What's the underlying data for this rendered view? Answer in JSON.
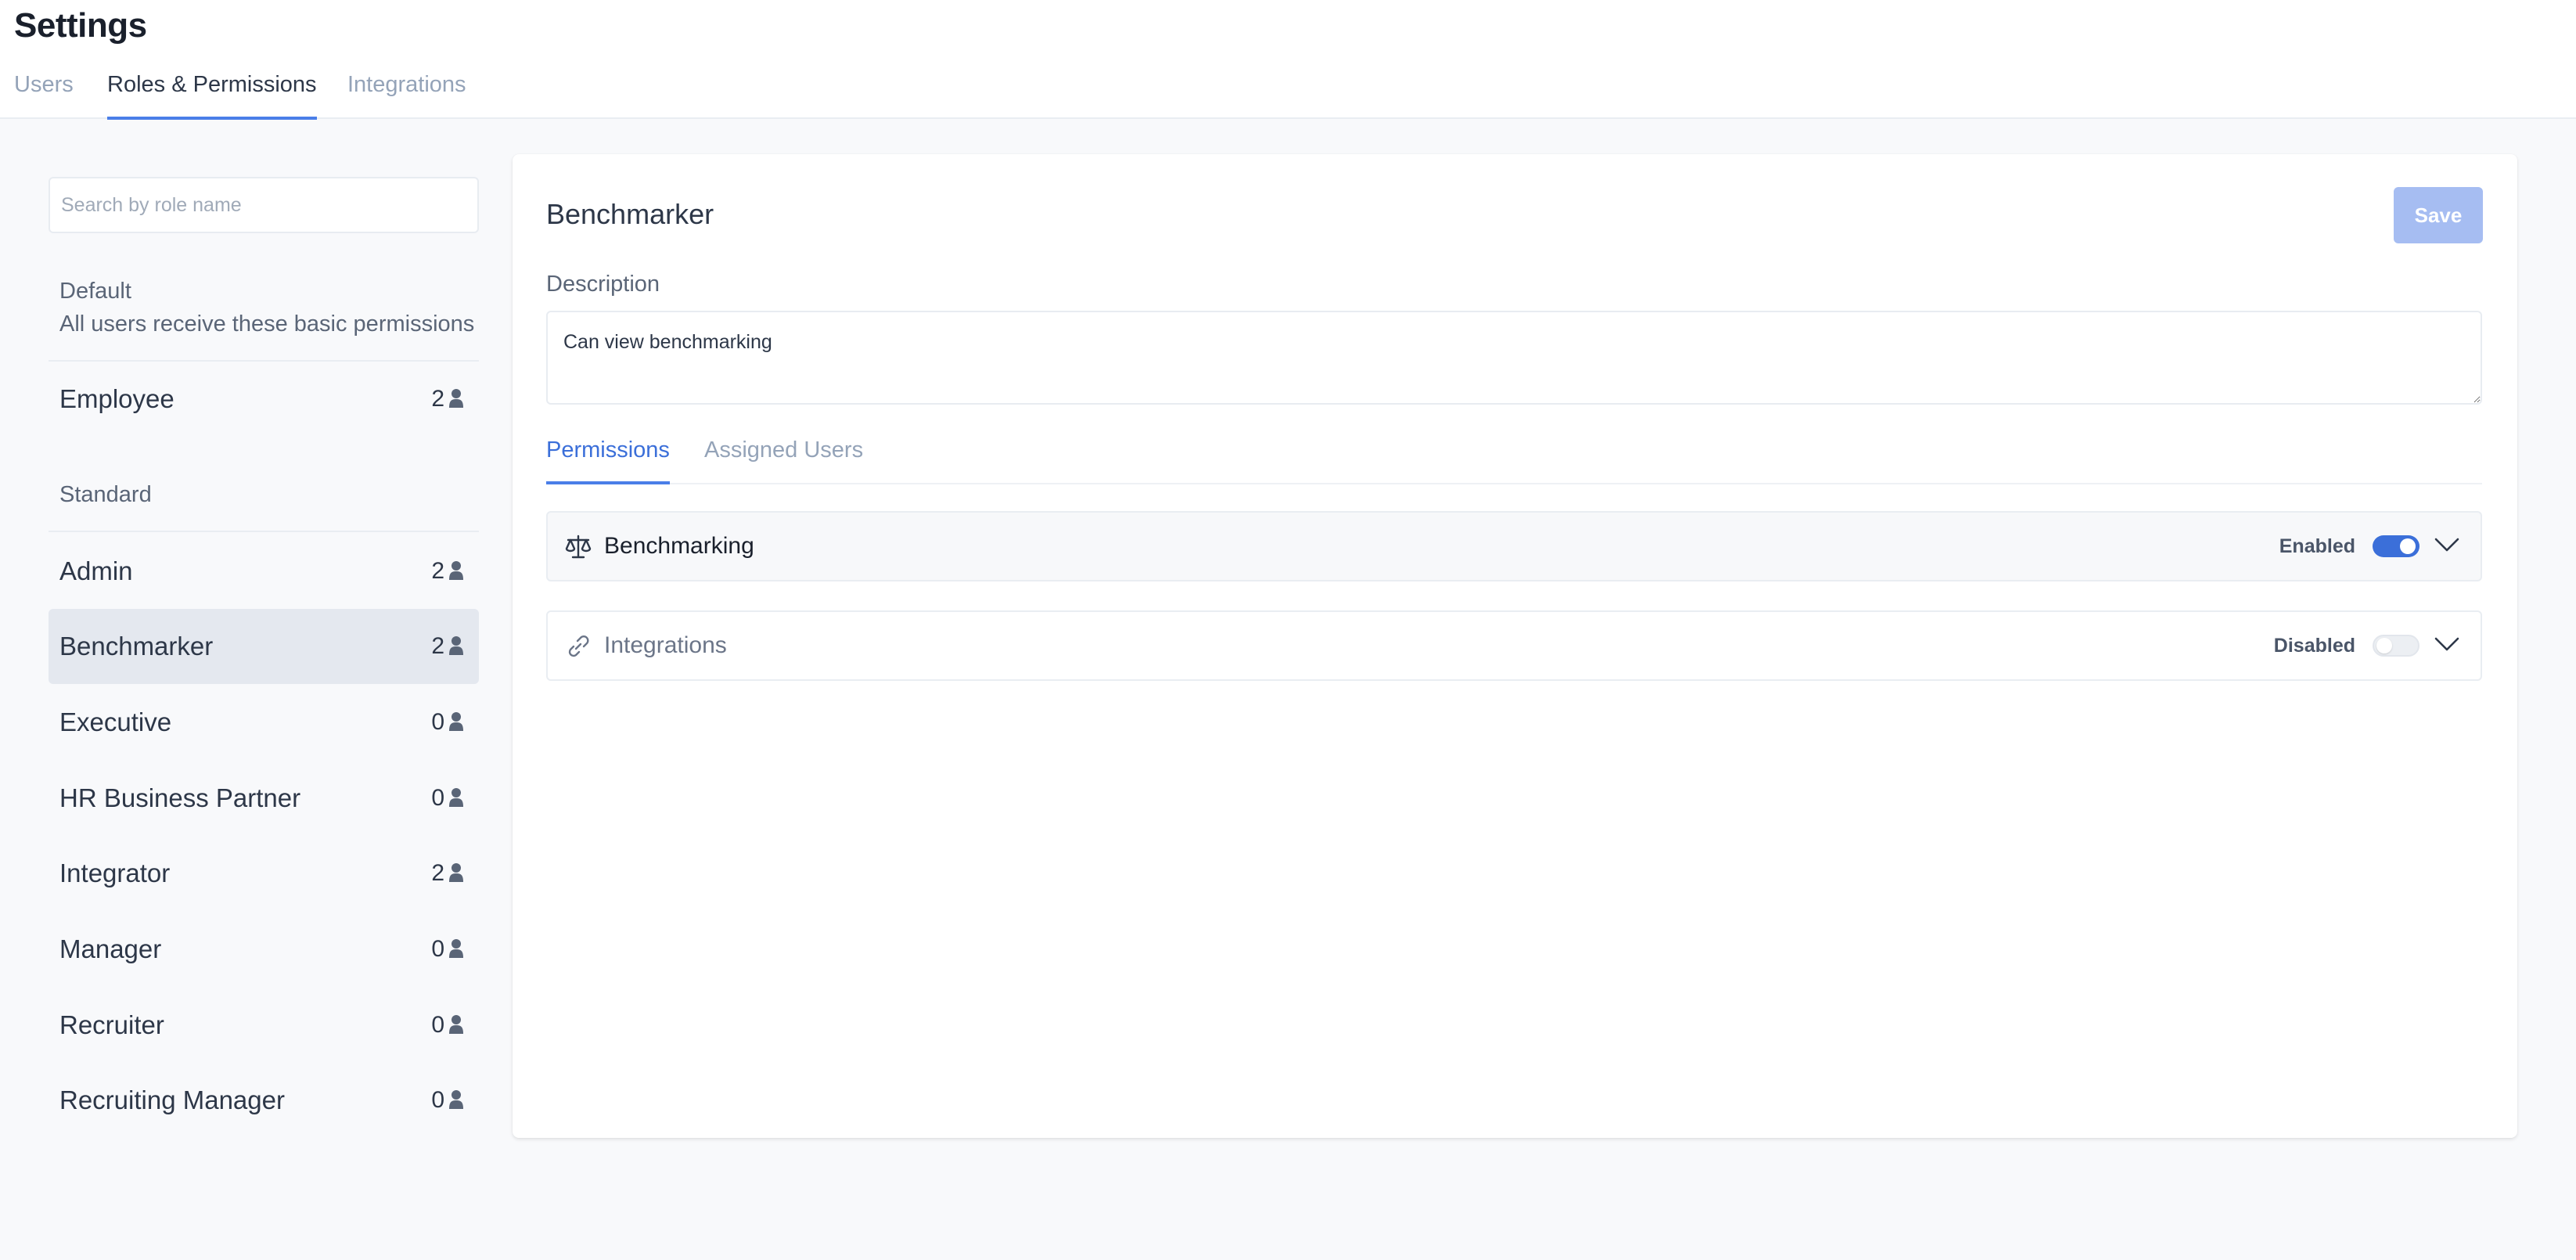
{
  "page": {
    "title": "Settings"
  },
  "top_tabs": [
    {
      "label": "Users",
      "active": false
    },
    {
      "label": "Roles & Permissions",
      "active": true
    },
    {
      "label": "Integrations",
      "active": false
    }
  ],
  "sidebar": {
    "search_placeholder": "Search by role name",
    "default_group": {
      "title": "Default",
      "subtitle": "All users receive these basic permissions",
      "roles": [
        {
          "name": "Employee",
          "count": "2"
        }
      ]
    },
    "standard_group": {
      "title": "Standard",
      "roles": [
        {
          "name": "Admin",
          "count": "2"
        },
        {
          "name": "Benchmarker",
          "count": "2",
          "selected": true
        },
        {
          "name": "Executive",
          "count": "0"
        },
        {
          "name": "HR Business Partner",
          "count": "0"
        },
        {
          "name": "Integrator",
          "count": "2"
        },
        {
          "name": "Manager",
          "count": "0"
        },
        {
          "name": "Recruiter",
          "count": "0"
        },
        {
          "name": "Recruiting Manager",
          "count": "0"
        }
      ]
    },
    "icon": "person-icon"
  },
  "detail": {
    "role_title": "Benchmarker",
    "save_label": "Save",
    "description_label": "Description",
    "description_value": "Can view benchmarking",
    "tabs": [
      {
        "label": "Permissions",
        "active": true
      },
      {
        "label": "Assigned Users",
        "active": false
      }
    ],
    "permissions": [
      {
        "name": "Benchmarking",
        "status": "Enabled",
        "enabled": true,
        "icon": "scale-icon"
      },
      {
        "name": "Integrations",
        "status": "Disabled",
        "enabled": false,
        "icon": "link-icon"
      }
    ]
  },
  "colors": {
    "accent": "#3b6fd9",
    "save_button_disabled": "#a6bdf2",
    "selected_row": "#e4e8ef",
    "page_background": "#f8f9fb"
  }
}
